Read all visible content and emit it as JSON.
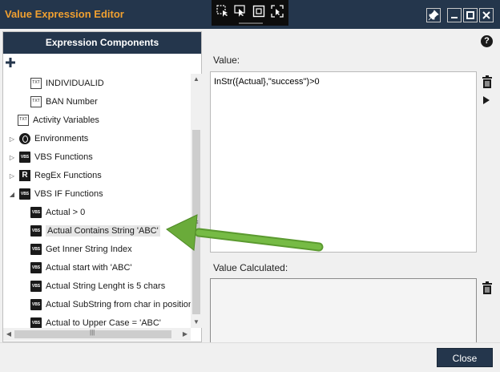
{
  "window": {
    "title": "Value Expression Editor"
  },
  "left_panel": {
    "header": "Expression Components",
    "tree": [
      {
        "label": "INDIVIDUALID",
        "icon": "text-field-icon",
        "level": 2,
        "expander": ""
      },
      {
        "label": "BAN Number",
        "icon": "text-field-icon",
        "level": 2,
        "expander": ""
      },
      {
        "label": "Activity Variables",
        "icon": "text-field-icon",
        "level": 1,
        "expander": ""
      },
      {
        "label": "Environments",
        "icon": "environment-icon",
        "level": 0,
        "expander": "▷"
      },
      {
        "label": "VBS Functions",
        "icon": "vbs-icon",
        "level": 0,
        "expander": "▷"
      },
      {
        "label": "RegEx Functions",
        "icon": "regex-icon",
        "level": 0,
        "expander": "▷"
      },
      {
        "label": "VBS IF Functions",
        "icon": "vbs-icon",
        "level": 0,
        "expander": "◢"
      },
      {
        "label": "Actual > 0",
        "icon": "vbs-icon",
        "level": 2,
        "expander": ""
      },
      {
        "label": "Actual Contains String 'ABC'",
        "icon": "vbs-icon",
        "level": 2,
        "expander": "",
        "selected": true
      },
      {
        "label": "Get Inner String Index",
        "icon": "vbs-icon",
        "level": 2,
        "expander": ""
      },
      {
        "label": "Actual start with 'ABC'",
        "icon": "vbs-icon",
        "level": 2,
        "expander": ""
      },
      {
        "label": "Actual String Lenght is 5 chars",
        "icon": "vbs-icon",
        "level": 2,
        "expander": ""
      },
      {
        "label": "Actual SubString from char in position",
        "icon": "vbs-icon",
        "level": 2,
        "expander": ""
      },
      {
        "label": "Actual to Upper Case = 'ABC'",
        "icon": "vbs-icon",
        "level": 2,
        "expander": ""
      }
    ],
    "scrollbar_grip": "≡",
    "hscroll_grip": "|||"
  },
  "right_panel": {
    "value_label": "Value:",
    "value_text": "InStr({Actual},\"success\")>0",
    "calculated_label": "Value Calculated:",
    "calculated_text": ""
  },
  "footer": {
    "close_label": "Close"
  },
  "colors": {
    "title_bar": "#24364c",
    "title_text": "#f0a030",
    "annotation_arrow": "#6aab3a"
  }
}
